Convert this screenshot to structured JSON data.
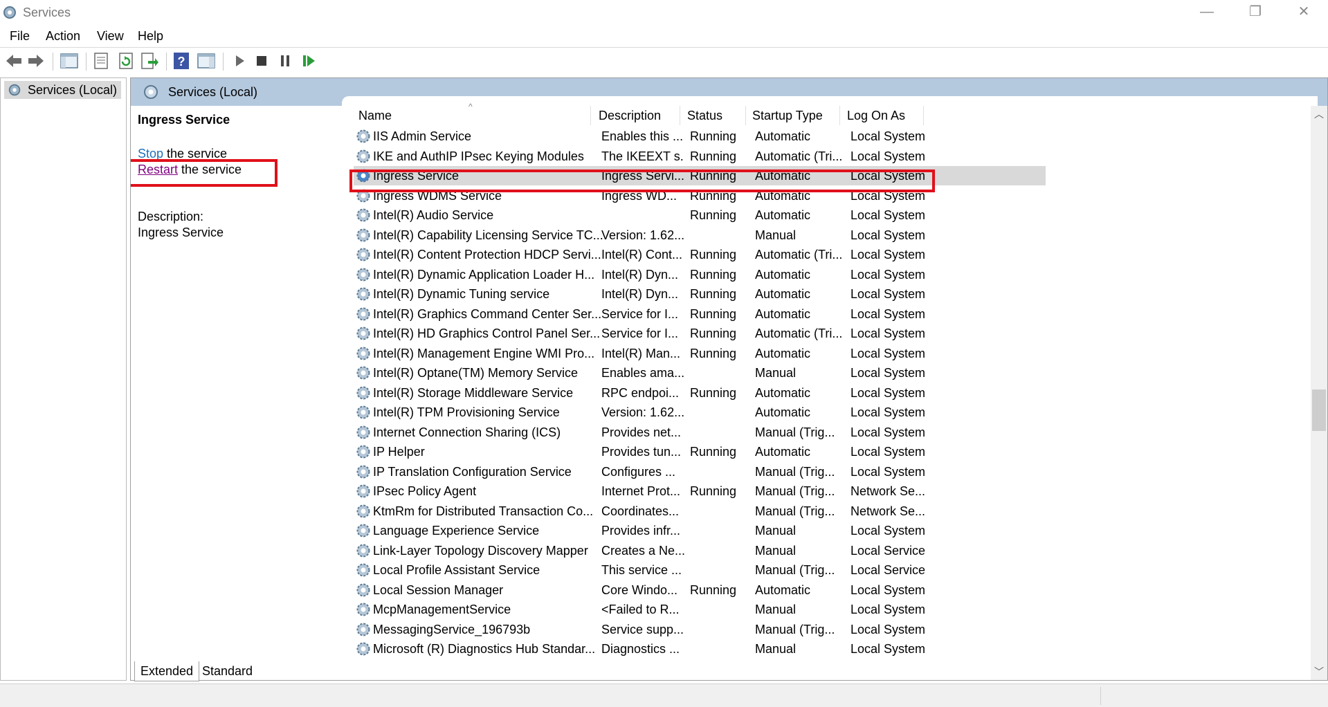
{
  "window": {
    "title": "Services",
    "minimize_label": "—",
    "maximize_label": "❐",
    "close_label": "✕"
  },
  "menu": [
    "File",
    "Action",
    "View",
    "Help"
  ],
  "toolbar_icons": [
    "back-arrow-icon",
    "forward-arrow-icon",
    "console-tree-icon",
    "properties-icon",
    "refresh-icon",
    "export-list-icon",
    "help-icon",
    "show-hide-pane-icon",
    "start-service-icon",
    "stop-service-icon",
    "pause-service-icon",
    "resume-service-icon"
  ],
  "tree": {
    "root_label": "Services (Local)"
  },
  "panel": {
    "title": "Services (Local)"
  },
  "detail": {
    "service_name": "Ingress Service",
    "stop_link": "Stop",
    "stop_suffix": " the service",
    "restart_link": "Restart",
    "restart_suffix": " the service",
    "description_label": "Description:",
    "description_text": "Ingress Service"
  },
  "columns": [
    "Name",
    "Description",
    "Status",
    "Startup Type",
    "Log On As"
  ],
  "sort_indicator": "^",
  "rows": [
    [
      "IIS Admin Service",
      "Enables this ...",
      "Running",
      "Automatic",
      "Local System"
    ],
    [
      "IKE and AuthIP IPsec Keying Modules",
      "The IKEEXT s...",
      "Running",
      "Automatic (Tri...",
      "Local System"
    ],
    [
      "Ingress Service",
      "Ingress Servi...",
      "Running",
      "Automatic",
      "Local System"
    ],
    [
      "Ingress WDMS Service",
      "Ingress WD...",
      "Running",
      "Automatic",
      "Local System"
    ],
    [
      "Intel(R) Audio Service",
      "",
      "Running",
      "Automatic",
      "Local System"
    ],
    [
      "Intel(R) Capability Licensing Service TC...",
      "Version: 1.62....",
      "",
      "Manual",
      "Local System"
    ],
    [
      "Intel(R) Content Protection HDCP Servi...",
      "Intel(R) Cont...",
      "Running",
      "Automatic (Tri...",
      "Local System"
    ],
    [
      "Intel(R) Dynamic Application Loader H...",
      "Intel(R) Dyn...",
      "Running",
      "Automatic",
      "Local System"
    ],
    [
      "Intel(R) Dynamic Tuning service",
      "Intel(R) Dyn...",
      "Running",
      "Automatic",
      "Local System"
    ],
    [
      "Intel(R) Graphics Command Center Ser...",
      "Service for I...",
      "Running",
      "Automatic",
      "Local System"
    ],
    [
      "Intel(R) HD Graphics Control Panel Ser...",
      "Service for I...",
      "Running",
      "Automatic (Tri...",
      "Local System"
    ],
    [
      "Intel(R) Management Engine WMI Pro...",
      "Intel(R) Man...",
      "Running",
      "Automatic",
      "Local System"
    ],
    [
      "Intel(R) Optane(TM) Memory Service",
      "Enables ama...",
      "",
      "Manual",
      "Local System"
    ],
    [
      "Intel(R) Storage Middleware Service",
      "RPC endpoi...",
      "Running",
      "Automatic",
      "Local System"
    ],
    [
      "Intel(R) TPM Provisioning Service",
      "Version: 1.62....",
      "",
      "Automatic",
      "Local System"
    ],
    [
      "Internet Connection Sharing (ICS)",
      "Provides net...",
      "",
      "Manual (Trig...",
      "Local System"
    ],
    [
      "IP Helper",
      "Provides tun...",
      "Running",
      "Automatic",
      "Local System"
    ],
    [
      "IP Translation Configuration Service",
      "Configures ...",
      "",
      "Manual (Trig...",
      "Local System"
    ],
    [
      "IPsec Policy Agent",
      "Internet Prot...",
      "Running",
      "Manual (Trig...",
      "Network Se..."
    ],
    [
      "KtmRm for Distributed Transaction Co...",
      "Coordinates...",
      "",
      "Manual (Trig...",
      "Network Se..."
    ],
    [
      "Language Experience Service",
      "Provides infr...",
      "",
      "Manual",
      "Local System"
    ],
    [
      "Link-Layer Topology Discovery Mapper",
      "Creates a Ne...",
      "",
      "Manual",
      "Local Service"
    ],
    [
      "Local Profile Assistant Service",
      "This service ...",
      "",
      "Manual (Trig...",
      "Local Service"
    ],
    [
      "Local Session Manager",
      "Core Windo...",
      "Running",
      "Automatic",
      "Local System"
    ],
    [
      "McpManagementService",
      "<Failed to R...",
      "",
      "Manual",
      "Local System"
    ],
    [
      "MessagingService_196793b",
      "Service supp...",
      "",
      "Manual (Trig...",
      "Local System"
    ],
    [
      "Microsoft (R) Diagnostics Hub Standar...",
      "Diagnostics ...",
      "",
      "Manual",
      "Local System"
    ]
  ],
  "selected_row_index": 2,
  "tabs": [
    "Extended",
    "Standard"
  ],
  "colors": {
    "highlight_box": "#e0101a",
    "header_band": "#b4c9de",
    "link": "#1e6fb9"
  }
}
